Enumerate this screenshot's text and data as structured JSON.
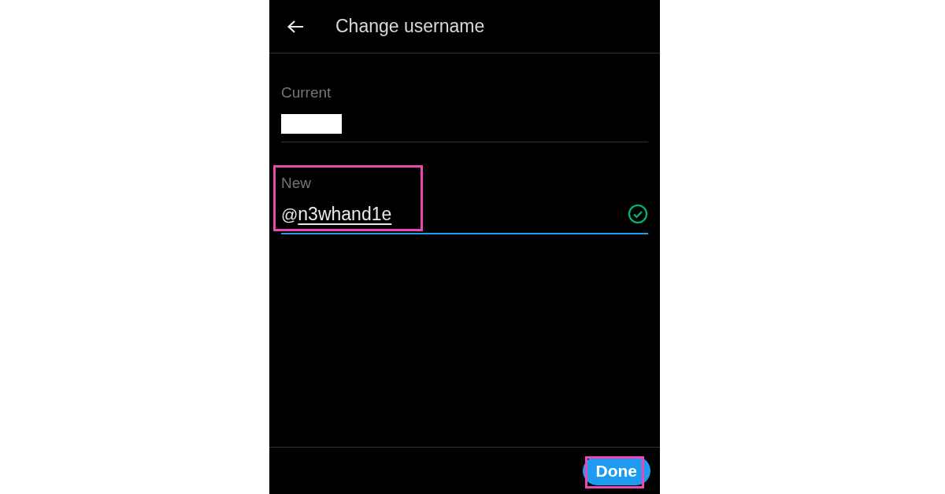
{
  "header": {
    "title": "Change username"
  },
  "current": {
    "label": "Current",
    "redacted": true
  },
  "new": {
    "label": "New",
    "prefix": "@",
    "value": "n3whand1e",
    "valid": true,
    "focused": true,
    "highlighted": true
  },
  "done_button": {
    "label": "Done",
    "highlighted": true
  }
}
